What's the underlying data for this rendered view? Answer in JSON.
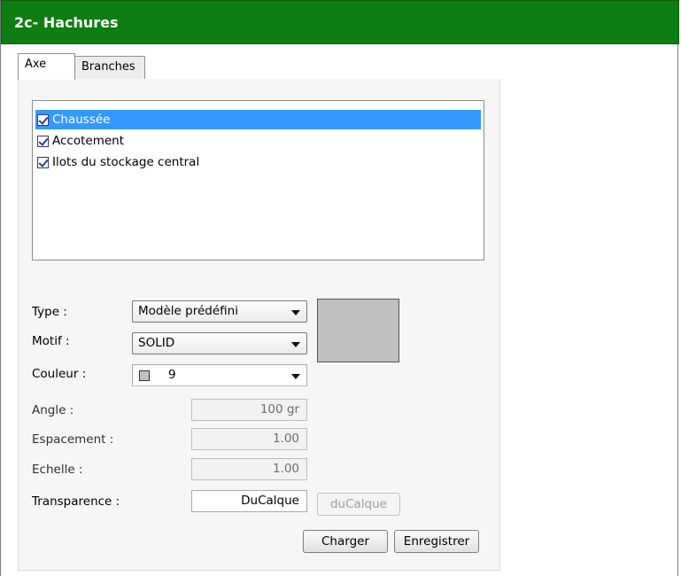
{
  "window": {
    "title": "2c- Hachures",
    "accent": "#0e7d12"
  },
  "tabs": [
    {
      "label": "Axe",
      "active": true
    },
    {
      "label": "Branches",
      "active": false
    }
  ],
  "list": {
    "items": [
      {
        "label": "Chaussée",
        "checked": true,
        "selected": true
      },
      {
        "label": "Accotement",
        "checked": true,
        "selected": false
      },
      {
        "label": "Ilots du stockage central",
        "checked": true,
        "selected": false
      }
    ]
  },
  "form": {
    "type": {
      "label": "Type :",
      "value": "Modèle prédéfini"
    },
    "motif": {
      "label": "Motif :",
      "value": "SOLID"
    },
    "couleur": {
      "label": "Couleur :",
      "value": "9",
      "swatch": "#c0c0c0"
    },
    "angle": {
      "label": "Angle :",
      "value": "100 gr"
    },
    "espacement": {
      "label": "Espacement :",
      "value": "1.00"
    },
    "echelle": {
      "label": "Echelle :",
      "value": "1.00"
    },
    "transparence": {
      "label": "Transparence :",
      "value": "DuCalque",
      "button": "duCalque"
    },
    "preview_color": "#c0c0c0"
  },
  "buttons": {
    "charger": "Charger",
    "enregistrer": "Enregistrer"
  }
}
